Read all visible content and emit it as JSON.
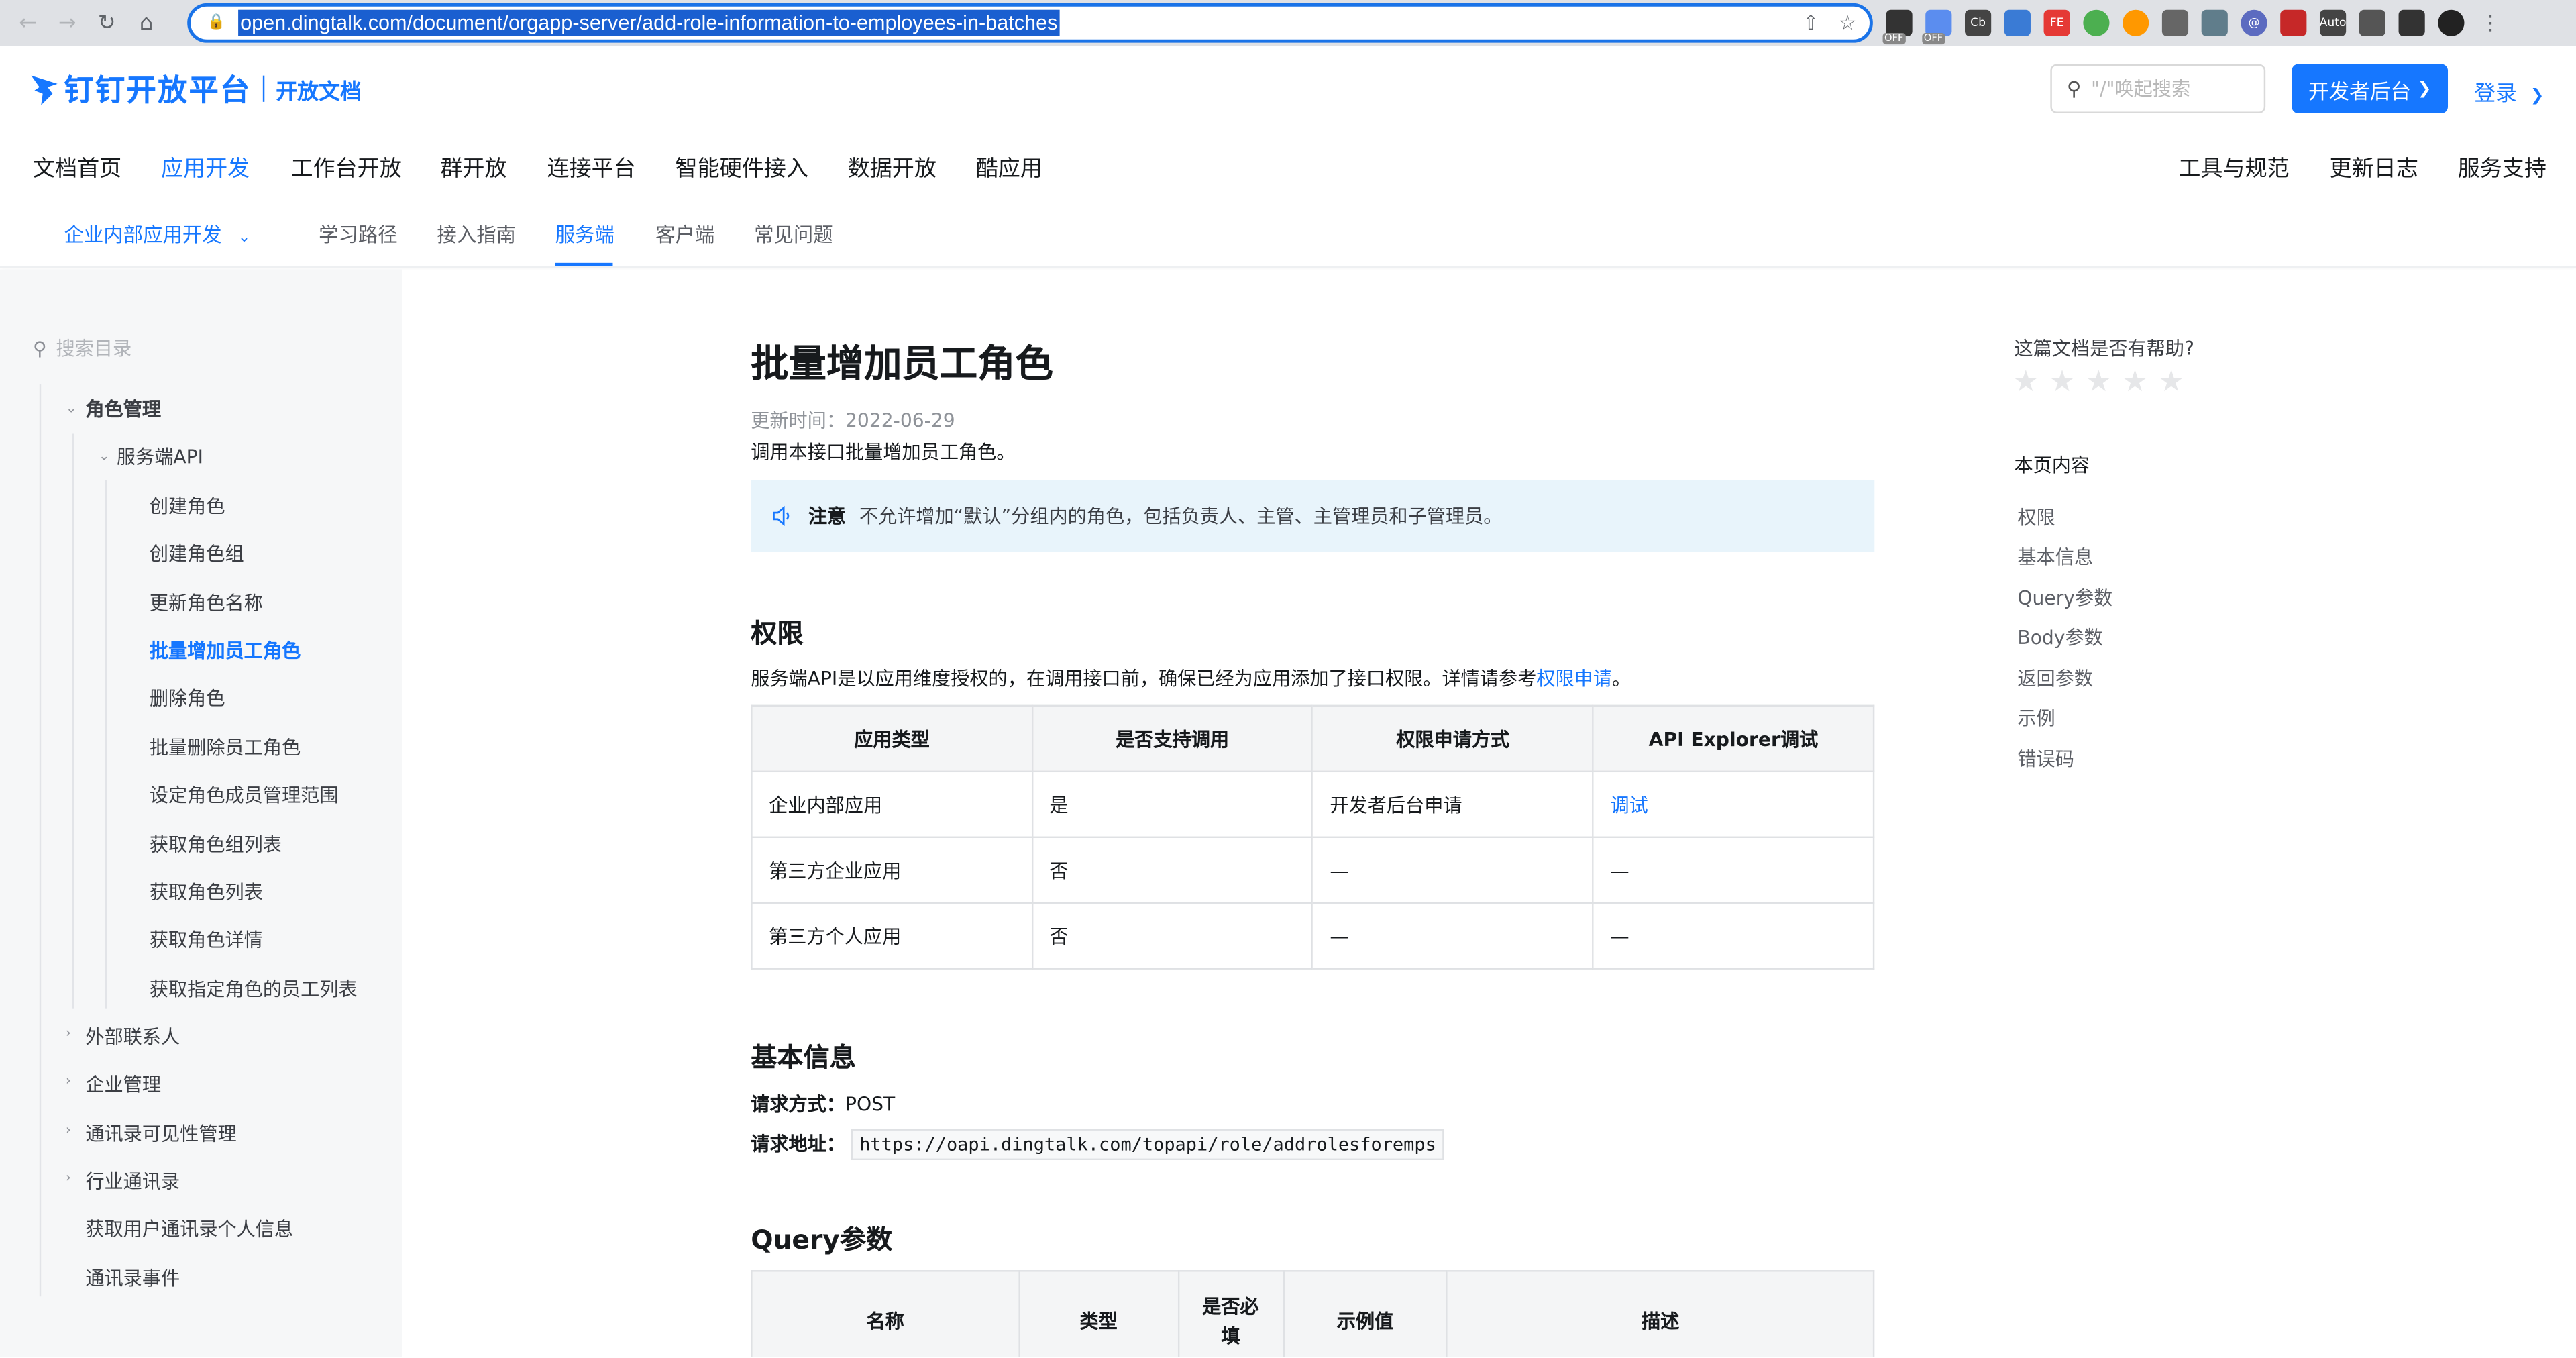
{
  "browser": {
    "url": "open.dingtalk.com/document/orgapp-server/add-role-information-to-employees-in-batches",
    "ext_off_label": "OFF"
  },
  "header": {
    "logo_title": "钉钉开放平台",
    "logo_subtitle": "开放文档",
    "search_placeholder": "\"/\"唤起搜索",
    "dev_button": "开发者后台",
    "login": "登录"
  },
  "main_nav": {
    "items": [
      "文档首页",
      "应用开发",
      "工作台开放",
      "群开放",
      "连接平台",
      "智能硬件接入",
      "数据开放",
      "酷应用"
    ],
    "right_items": [
      "工具与规范",
      "更新日志",
      "服务支持"
    ],
    "active_index": 1
  },
  "sub_nav": {
    "selector": "企业内部应用开发",
    "items": [
      "学习路径",
      "接入指南",
      "服务端",
      "客户端",
      "常见问题"
    ],
    "active_index": 2
  },
  "sidebar": {
    "search_placeholder": "搜索目录",
    "group": "角色管理",
    "subgroup": "服务端API",
    "items": [
      "创建角色",
      "创建角色组",
      "更新角色名称",
      "批量增加员工角色",
      "删除角色",
      "批量删除员工角色",
      "设定角色成员管理范围",
      "获取角色组列表",
      "获取角色列表",
      "获取角色详情",
      "获取指定角色的员工列表"
    ],
    "active_item": "批量增加员工角色",
    "sections": [
      "外部联系人",
      "企业管理",
      "通讯录可见性管理",
      "行业通讯录"
    ],
    "plain_items": [
      "获取用户通讯录个人信息",
      "通讯录事件"
    ]
  },
  "article": {
    "title": "批量增加员工角色",
    "updated_label": "更新时间：",
    "updated": "2022-06-29",
    "description": "调用本接口批量增加员工角色。",
    "notice_label": "注意",
    "notice_text": "不允许增加“默认”分组内的角色，包括负责人、主管、主管理员和子管理员。",
    "permission_heading": "权限",
    "permission_text": "服务端API是以应用维度授权的，在调用接口前，确保已经为应用添加了接口权限。详情请参考",
    "permission_link": "权限申请",
    "permission_end": "。",
    "perm_table": {
      "headers": [
        "应用类型",
        "是否支持调用",
        "权限申请方式",
        "API Explorer调试"
      ],
      "rows": [
        [
          "企业内部应用",
          "是",
          "开发者后台申请",
          "调试"
        ],
        [
          "第三方企业应用",
          "否",
          "—",
          "—"
        ],
        [
          "第三方个人应用",
          "否",
          "—",
          "—"
        ]
      ]
    },
    "basic_heading": "基本信息",
    "method_label": "请求方式：",
    "method": "POST",
    "address_label": "请求地址：",
    "address": "https://oapi.dingtalk.com/topapi/role/addrolesforemps",
    "query_heading": "Query参数",
    "query_table": {
      "headers": [
        "名称",
        "类型",
        "是否必填",
        "示例值",
        "描述"
      ]
    }
  },
  "right_panel": {
    "helpful_question": "这篇文档是否有帮助?",
    "rating": 0,
    "toc_title": "本页内容",
    "toc": [
      "权限",
      "基本信息",
      "Query参数",
      "Body参数",
      "返回参数",
      "示例",
      "错误码"
    ]
  },
  "colors": {
    "brand": "#1677ff",
    "notice_bg": "#e8f4fb",
    "sidebar_bg": "#f6f7f8"
  }
}
